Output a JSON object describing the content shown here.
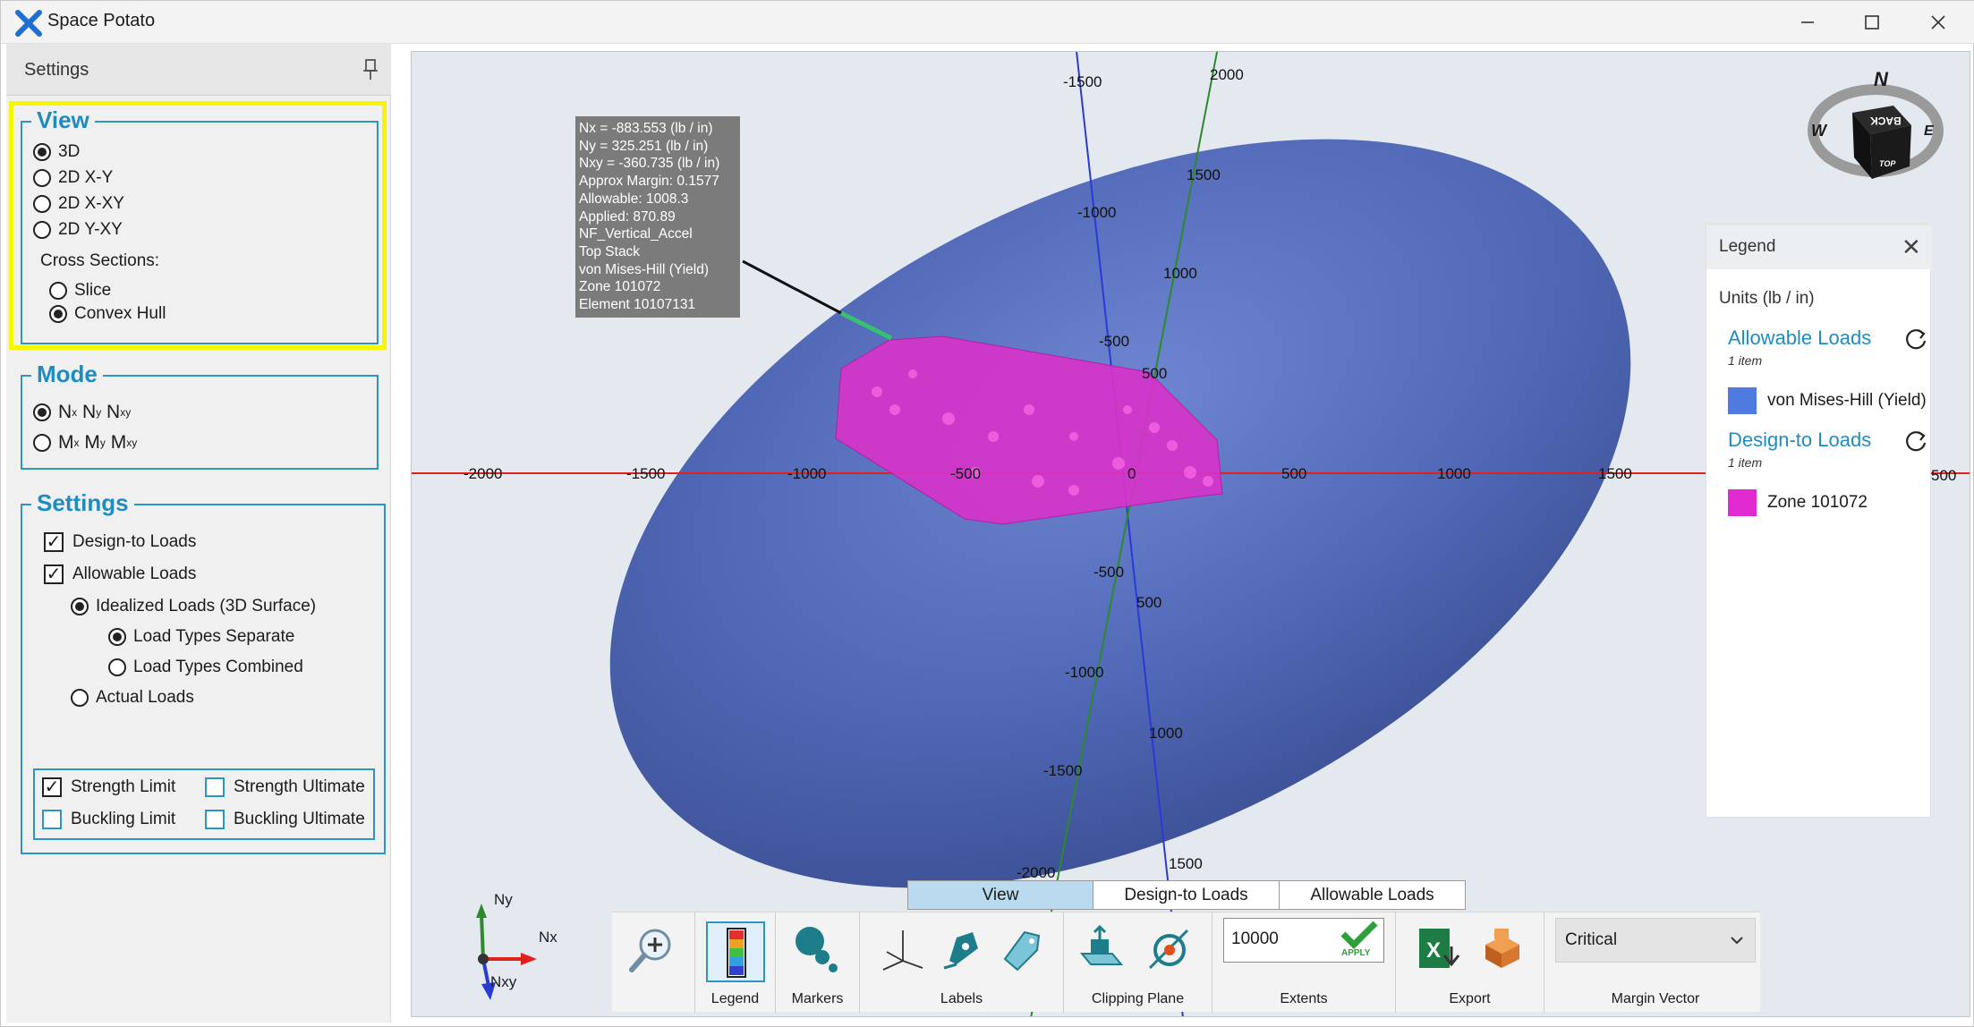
{
  "app": {
    "title": "Space Potato"
  },
  "settings_panel": {
    "title": "Settings",
    "view_group": {
      "title": "View",
      "options": [
        "3D",
        "2D X-Y",
        "2D X-XY",
        "2D Y-XY"
      ],
      "selected": "3D",
      "cross_sections_label": "Cross Sections:",
      "cross_sections": [
        "Slice",
        "Convex Hull"
      ],
      "cross_section_selected": "Convex Hull"
    },
    "mode_group": {
      "title": "Mode",
      "option1": {
        "a": "N",
        "a_sub": "x",
        "b": "N",
        "b_sub": "y",
        "c": "N",
        "c_sub": "xy"
      },
      "option2": {
        "a": "M",
        "a_sub": "x",
        "b": "M",
        "b_sub": "y",
        "c": "M",
        "c_sub": "xy"
      },
      "selected": "N"
    },
    "settings_group": {
      "title": "Settings",
      "design_to_loads": "Design-to Loads",
      "allowable_loads": "Allowable Loads",
      "idealized_loads": "Idealized Loads (3D Surface)",
      "load_types_separate": "Load Types Separate",
      "load_types_combined": "Load Types Combined",
      "actual_loads": "Actual Loads",
      "strength_limit": "Strength Limit",
      "strength_ultimate": "Strength Ultimate",
      "buckling_limit": "Buckling Limit",
      "buckling_ultimate": "Buckling Ultimate"
    }
  },
  "viewport": {
    "tooltip_lines": [
      "Nx = -883.553 (lb / in)",
      "Ny = 325.251 (lb / in)",
      "Nxy = -360.735 (lb / in)",
      "Approx Margin: 0.1577",
      "Allowable: 1008.3",
      "Applied: 870.89",
      "NF_Vertical_Accel",
      "Top Stack",
      "von Mises-Hill (Yield)",
      "Zone 101072",
      "Element 10107131"
    ],
    "x_ticks": [
      "-2000",
      "-1500",
      "-1000",
      "-500",
      "0",
      "500",
      "1000",
      "1500",
      "500"
    ],
    "y_ticks": [
      "-1500",
      "-1000",
      "-500",
      "500",
      "-500",
      "500",
      "-1000",
      "1000",
      "-1500",
      "-2000"
    ],
    "green_ticks": [
      "2000",
      "1500",
      "1000",
      "1500"
    ],
    "compass": {
      "n": "N",
      "w": "W",
      "e": "E",
      "back": "BACK",
      "top": "TOP"
    },
    "triad": {
      "ny": "Ny",
      "nx": "Nx",
      "nxy": "Nxy"
    },
    "colors": {
      "potato": "#5068b3",
      "design_loads": "#d633c9",
      "x_axis": "#e0201c",
      "y_axis": "#2a3ad8",
      "z_axis": "#2c8a2c"
    }
  },
  "legend": {
    "title": "Legend",
    "units": "Units (lb / in)",
    "allowable_title": "Allowable Loads",
    "allowable_count": "1 item",
    "allowable_item": "von Mises-Hill (Yield)",
    "allowable_color": "#4f7be0",
    "design_title": "Design-to Loads",
    "design_count": "1 item",
    "design_item": "Zone 101072",
    "design_color": "#e22ad2"
  },
  "tabs": [
    {
      "label": "View",
      "active": true
    },
    {
      "label": "Design-to Loads",
      "active": false
    },
    {
      "label": "Allowable Loads",
      "active": false
    }
  ],
  "toolbar": {
    "legend_label": "Legend",
    "markers_label": "Markers",
    "labels_label": "Labels",
    "clipping_label": "Clipping Plane",
    "extents_label": "Extents",
    "extents_value": "10000",
    "apply_label": "APPLY",
    "export_label": "Export",
    "margin_label": "Margin Vector",
    "margin_value": "Critical"
  }
}
